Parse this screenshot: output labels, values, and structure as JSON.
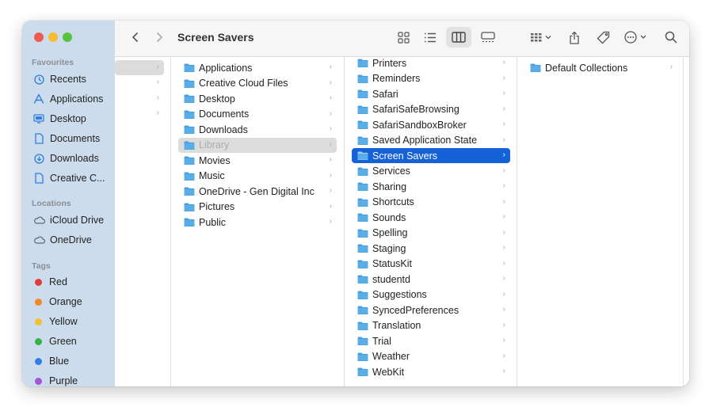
{
  "window": {
    "title": "Screen Savers"
  },
  "sidebar": {
    "favourites_heading": "Favourites",
    "favourites": [
      {
        "label": "Recents",
        "icon": "clock-icon"
      },
      {
        "label": "Applications",
        "icon": "applications-icon"
      },
      {
        "label": "Desktop",
        "icon": "desktop-icon"
      },
      {
        "label": "Documents",
        "icon": "document-icon"
      },
      {
        "label": "Downloads",
        "icon": "download-icon"
      },
      {
        "label": "Creative C...",
        "icon": "document-icon"
      }
    ],
    "locations_heading": "Locations",
    "locations": [
      {
        "label": "iCloud Drive",
        "icon": "cloud-icon"
      },
      {
        "label": "OneDrive",
        "icon": "cloud-icon"
      }
    ],
    "tags_heading": "Tags",
    "tags": [
      {
        "label": "Red",
        "color": "#e23b3b"
      },
      {
        "label": "Orange",
        "color": "#f08a24"
      },
      {
        "label": "Yellow",
        "color": "#f2c12e"
      },
      {
        "label": "Green",
        "color": "#36b24a"
      },
      {
        "label": "Blue",
        "color": "#2f7ee0"
      },
      {
        "label": "Purple",
        "color": "#a256d6"
      }
    ]
  },
  "toolbar": {
    "back_icon": "chevron-left-icon",
    "forward_icon": "chevron-right-icon",
    "views": [
      "icon-view",
      "list-view",
      "column-view",
      "gallery-view"
    ],
    "active_view": "column-view"
  },
  "column_user": {
    "items": [
      {
        "label": "Applications"
      },
      {
        "label": "Creative Cloud Files"
      },
      {
        "label": "Desktop"
      },
      {
        "label": "Documents"
      },
      {
        "label": "Downloads"
      },
      {
        "label": "Library",
        "state": "selected-inactive"
      },
      {
        "label": "Movies"
      },
      {
        "label": "Music"
      },
      {
        "label": "OneDrive - Gen Digital Inc"
      },
      {
        "label": "Pictures"
      },
      {
        "label": "Public"
      }
    ]
  },
  "column_library": {
    "items": [
      {
        "label": "Printers"
      },
      {
        "label": "Reminders"
      },
      {
        "label": "Safari"
      },
      {
        "label": "SafariSafeBrowsing"
      },
      {
        "label": "SafariSandboxBroker"
      },
      {
        "label": "Saved Application State"
      },
      {
        "label": "Screen Savers",
        "state": "selected"
      },
      {
        "label": "Services"
      },
      {
        "label": "Sharing"
      },
      {
        "label": "Shortcuts"
      },
      {
        "label": "Sounds"
      },
      {
        "label": "Spelling"
      },
      {
        "label": "Staging"
      },
      {
        "label": "StatusKit"
      },
      {
        "label": "studentd"
      },
      {
        "label": "Suggestions"
      },
      {
        "label": "SyncedPreferences"
      },
      {
        "label": "Translation"
      },
      {
        "label": "Trial"
      },
      {
        "label": "Weather"
      },
      {
        "label": "WebKit"
      }
    ]
  },
  "column_screensavers": {
    "items": [
      {
        "label": "Default Collections"
      }
    ]
  },
  "colors": {
    "accent": "#1561d8",
    "folder": "#5aaee8",
    "sidebar": "#ccdcec"
  }
}
